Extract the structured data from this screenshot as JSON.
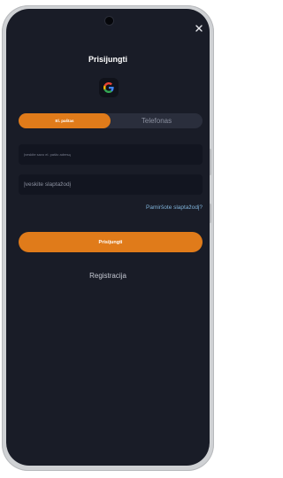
{
  "header": {
    "title": "Prisijungti",
    "close_icon": "close-icon"
  },
  "social": {
    "google_icon": "google-icon"
  },
  "tabs": {
    "email_label": "El. paštas",
    "phone_label": "Telefonas",
    "active": "email"
  },
  "form": {
    "email_placeholder": "Įveskite savo el. pašto adresą",
    "password_placeholder": "Įveskite slaptažodį",
    "forgot_label": "Pamiršote slaptažodį?",
    "submit_label": "Prisijungti"
  },
  "footer": {
    "register_label": "Registracija"
  },
  "colors": {
    "accent": "#e07b1a",
    "background": "#191c27",
    "link": "#7fb2d9"
  }
}
